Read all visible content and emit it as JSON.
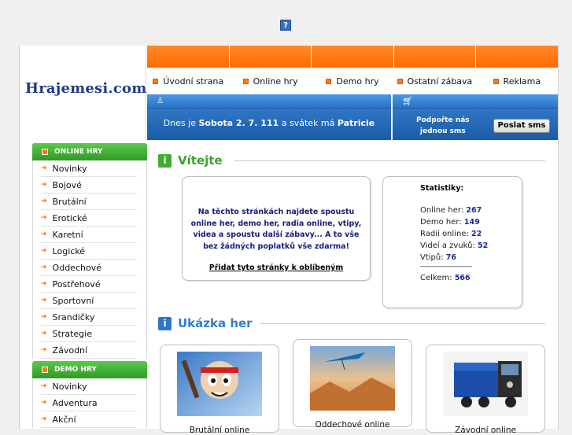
{
  "header": {
    "logo_text": "Hrajemesi.com",
    "help_icon_label": "?"
  },
  "menu": [
    {
      "label": "Úvodní strana"
    },
    {
      "label": "Online hry"
    },
    {
      "label": "Demo hry"
    },
    {
      "label": "Ostatní zábava"
    },
    {
      "label": "Reklama"
    }
  ],
  "date_bar": {
    "prefix": "Dnes je",
    "date": "Sobota 2. 7. 111",
    "middle": "a svátek má",
    "name": "Patricie"
  },
  "sms": {
    "text_line1": "Podpořte nás",
    "text_line2": "jednou sms",
    "button_label": "Poslat sms"
  },
  "sidebar": {
    "online": {
      "title": "ONLINE HRY",
      "items": [
        "Novinky",
        "Bojové",
        "Brutální",
        "Erotické",
        "Karetní",
        "Logické",
        "Oddechové",
        "Postřehové",
        "Sportovní",
        "Srandičky",
        "Strategie",
        "Závodní"
      ]
    },
    "demo": {
      "title": "DEMO HRY",
      "items": [
        "Novinky",
        "Adventura",
        "Akční"
      ]
    }
  },
  "welcome": {
    "title": "Vítejte",
    "line1": "Na těchto stránkách najdete spoustu",
    "line2": "online her, demo her, radia online, vtipy,",
    "line3": "videa a spoustu další zábavy... A to vše",
    "line4": "bez žádných poplatků vše zdarma!",
    "favorite_link": "Přidat tyto stránky k oblíbeným"
  },
  "stats": {
    "title": "Statistiky:",
    "rows": [
      {
        "label": "Online her:",
        "value": "267"
      },
      {
        "label": "Demo her:",
        "value": "149"
      },
      {
        "label": "Radii online:",
        "value": "22"
      },
      {
        "label": "Videí a zvuků:",
        "value": "52"
      },
      {
        "label": "Vtipů:",
        "value": "76"
      }
    ],
    "separator": "------------------------",
    "total_label": "Celkem:",
    "total_value": "566"
  },
  "games": {
    "title": "Ukázka her",
    "items": [
      {
        "caption": "Brutální online"
      },
      {
        "caption": "Oddechové online"
      },
      {
        "caption": "Závodní online"
      }
    ]
  },
  "colors": {
    "orange": "#ff7a10",
    "blue": "#2a73c5",
    "green": "#3fae2f",
    "title_blue": "#2f7fd0"
  }
}
